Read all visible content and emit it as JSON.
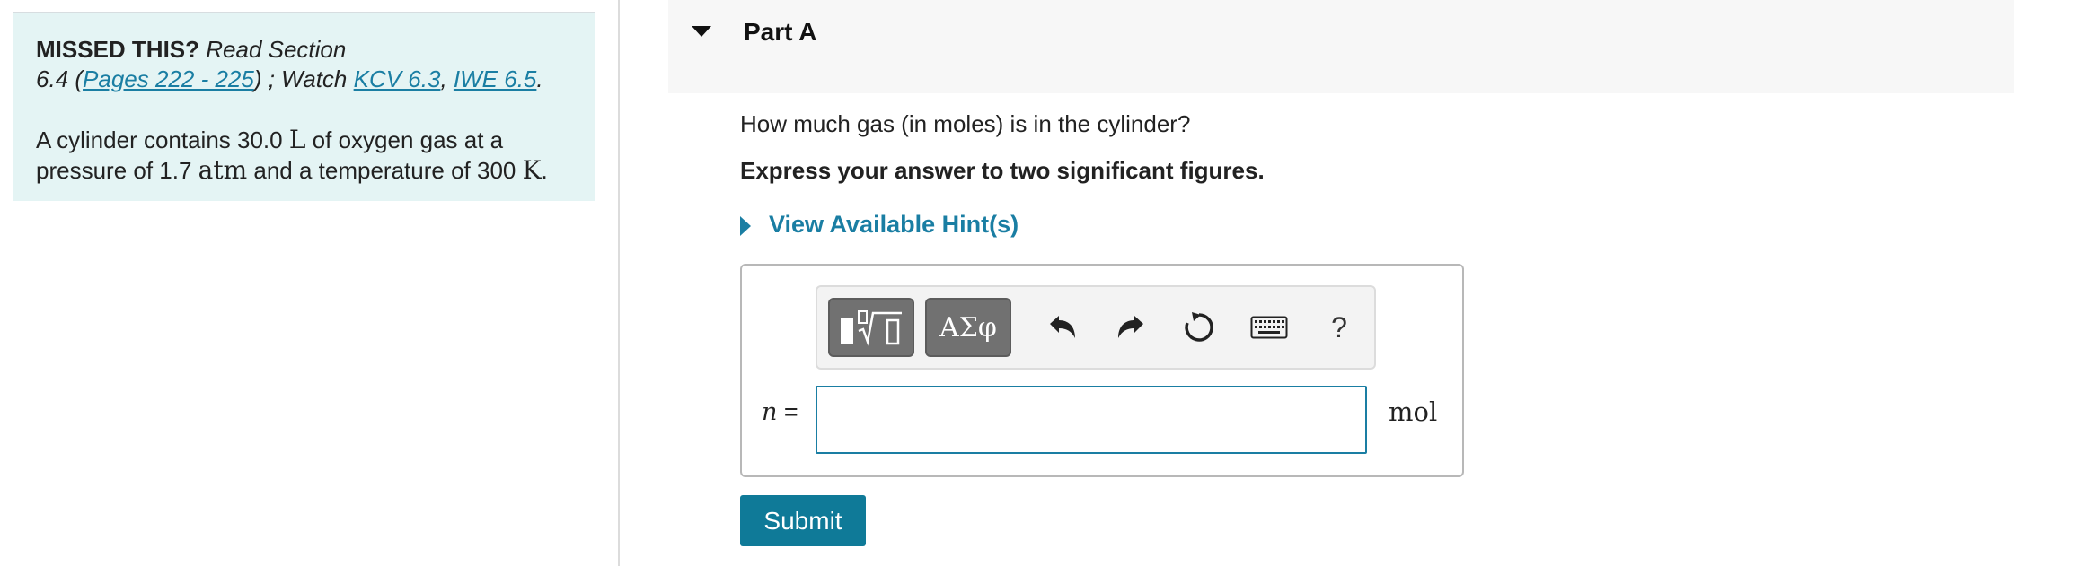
{
  "sidebar": {
    "missed_label": "MISSED THIS?",
    "read_section_text": "Read Section",
    "section_number": "6.4 (",
    "pages_link": "Pages 222 - 225",
    "after_pages": ") ; Watch ",
    "kcv_link": "KCV 6.3",
    "comma": ", ",
    "iwe_link": "IWE 6.5",
    "period": ".",
    "problem_part1": "A cylinder contains 30.0 ",
    "unit_L": "L",
    "problem_part2": " of oxygen gas at a pressure of 1.7 ",
    "unit_atm": "atm",
    "problem_part3": " and a temperature of 300 ",
    "unit_K": "K",
    "problem_end": "."
  },
  "part": {
    "title": "Part A",
    "question": "How much gas (in moles) is in the cylinder?",
    "instruction": "Express your answer to two significant figures.",
    "hint_label": "View Available Hint(s)"
  },
  "answer": {
    "variable": "n",
    "equals": " =",
    "value": "",
    "unit": "mol"
  },
  "toolbar": {
    "greek_label": "ΑΣφ",
    "help_label": "?"
  },
  "submit_label": "Submit",
  "colors": {
    "accent": "#1a7ea3",
    "submit_bg": "#0f7a98",
    "sidebar_bg": "#e4f4f4",
    "toolbar_btn": "#717171"
  }
}
